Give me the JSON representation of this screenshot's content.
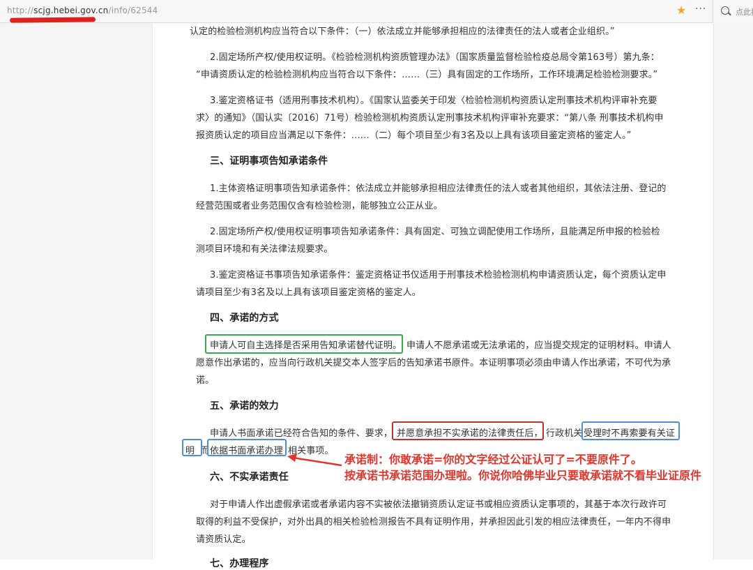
{
  "browser": {
    "url_prefix": "http://",
    "url_host": "scjg.hebei.gov.cn",
    "url_path": "/info/62544",
    "search_placeholder": "点此搜"
  },
  "article": {
    "lines": [
      "认定的检验检测机构应当符合以下条件：（一）依法成立并能够承担相应的法律责任的法人或者企业组织。”",
      "2.固定场所产权/使用权证明。《检验检测机构资质管理办法》（国家质量监督检验检疫总局令第163号）第九条：",
      "“申请资质认定的检验检测机构应当符合以下条件：……（三）具有固定的工作场所，工作环境满足检验检测要求。”",
      "3.鉴定资格证书（适用刑事技术机构）。《国家认监委关于印发〈检验检测机构资质认定刑事技术机构评审补充要",
      "求〉的通知》（国认实〔2016〕71号）检验检测机构资质认定刑事技术机构评审补充要求：“第八条 刑事技术机构申",
      "报资质认定的项目应当满足以下条件：……（二）每个项目至少有3名及以上具有该项目鉴定资格的鉴定人。”",
      "三、证明事项告知承诺条件",
      "1.主体资格证明事项告知承诺条件：依法成立并能够承担相应法律责任的法人或者其他组织，其依法注册、登记的",
      "经营范围或者业务范围仅含有检验检测，能够独立公正从业。",
      "2.固定场所产权/使用权证明事项告知承诺条件：具有固定、可独立调配使用工作场所，且能满足所申报的检验检",
      "测项目环境和有关法律法规要求。",
      "3.鉴定资格证书事项告知承诺条件：鉴定资格证书仅适用于刑事技术检验检测机构申请资质认定，每个资质认定申",
      "请项目至少有3名及以上具有该项目鉴定资格的鉴定人。",
      "四、承诺的方式",
      "申请人可自主选择是否采用告知承诺替代证明。",
      "申请人不愿承诺或无法承诺的，应当提交规定的证明材料。申请人",
      "愿意作出承诺的，应当向行政机关提交本人签字后的告知承诺书原件。本证明事项必须由申请人作出承诺，不可代为承",
      "诺。",
      "五、承诺的效力",
      "申请人书面承诺已经符合告知的条件、要求，",
      "并愿意承担不实承诺的法律责任后，",
      "行政机关",
      "受理时不再索要有关证",
      "明",
      "而",
      "依据书面承诺办理",
      "相关事项。",
      "六、不实承诺责任",
      "对于申请人作出虚假承诺或者承诺内容不实被依法撤销资质认定证书或相应资质认定事项的，其基于本次行政许可",
      "取得的利益不受保护，对外出具的相关检验检测报告不具有证明作用，并承担因此引发的相应法律责任，一年内不得申",
      "请资质认定。",
      "七、办理程序"
    ]
  },
  "annotation": {
    "line1": "承诺制：你敢承诺=你的文字经过公证认可了=不要原件了。",
    "line2": "按承诺书承诺范围办理啦。你说你哈佛毕业只要敢承诺就不看毕业证原件"
  },
  "colors": {
    "highlight_green": "#3aa94a",
    "highlight_red": "#c0302a",
    "highlight_blue": "#4d8fd6",
    "annotation_red": "#e2352c",
    "url_underline": "#e0201b",
    "star": "#f0a81c"
  },
  "icons": [
    "star-icon",
    "more-icon",
    "search-icon",
    "arrow-icon"
  ]
}
